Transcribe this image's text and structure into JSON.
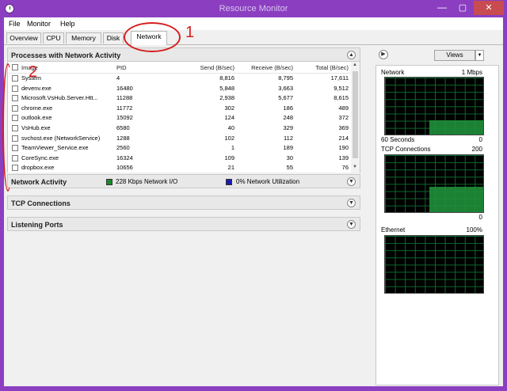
{
  "window": {
    "title": "Resource Monitor",
    "minimize": "—",
    "maximize": "▢",
    "close": "✕"
  },
  "menu": [
    "File",
    "Monitor",
    "Help"
  ],
  "tabs": [
    "Overview",
    "CPU",
    "Memory",
    "Disk",
    "Network"
  ],
  "active_tab": "Network",
  "processes": {
    "title": "Processes with Network Activity",
    "columns": [
      "Image",
      "PID",
      "Send (B/sec)",
      "Receive (B/sec)",
      "Total (B/sec)"
    ],
    "rows": [
      [
        "System",
        "4",
        "8,816",
        "8,795",
        "17,611"
      ],
      [
        "devenv.exe",
        "16480",
        "5,848",
        "3,663",
        "9,512"
      ],
      [
        "Microsoft.VsHub.Server.Htt...",
        "11288",
        "2,938",
        "5,677",
        "8,615"
      ],
      [
        "chrome.exe",
        "11772",
        "302",
        "186",
        "489"
      ],
      [
        "outlook.exe",
        "15092",
        "124",
        "248",
        "372"
      ],
      [
        "VsHub.exe",
        "6580",
        "40",
        "329",
        "369"
      ],
      [
        "svchost.exe (NetworkService)",
        "1288",
        "102",
        "112",
        "214"
      ],
      [
        "TeamViewer_Service.exe",
        "2560",
        "1",
        "189",
        "190"
      ],
      [
        "CoreSync.exe",
        "16324",
        "109",
        "30",
        "139"
      ],
      [
        "dropbox.exe",
        "10656",
        "21",
        "55",
        "76"
      ]
    ]
  },
  "network_activity": {
    "title": "Network Activity",
    "io_text": "228 Kbps Network I/O",
    "util_text": "0% Network Utilization",
    "io_color": "#1a8a2a",
    "util_color": "#1a1ab0"
  },
  "tcp": {
    "title": "TCP Connections"
  },
  "listening": {
    "title": "Listening Ports"
  },
  "right_panel": {
    "views_label": "Views",
    "graphs": [
      {
        "title": "Network",
        "max_label": "1 Mbps",
        "foot_left": "60 Seconds",
        "foot_right": "0",
        "level": 0.25
      },
      {
        "title": "TCP Connections",
        "max_label": "200",
        "foot_left": "",
        "foot_right": "0",
        "level": 0.45
      },
      {
        "title": "Ethernet",
        "max_label": "100%",
        "foot_left": "",
        "foot_right": "",
        "level": 0.0
      }
    ]
  },
  "annotations": {
    "one": "1",
    "two": "2"
  },
  "icons": [
    "app-icon",
    "chevron-up-icon",
    "chevron-down-icon",
    "expand-right-icon",
    "dropdown-arrow-icon"
  ]
}
